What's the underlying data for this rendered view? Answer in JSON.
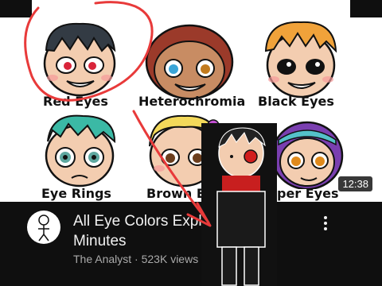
{
  "thumbnail": {
    "labels": {
      "red_eyes": "Red Eyes",
      "heterochromia": "Heterochromia",
      "black_eyes": "Black Eyes",
      "eye_rings": "Eye Rings",
      "brown_eyes": "Brown Ey",
      "amber_eyes": "per Eyes"
    },
    "duration": "12:38"
  },
  "video": {
    "title": "All Eye Colors Expla",
    "title_line2": "Minutes",
    "channel": "The Analyst",
    "separator": " · ",
    "views": "523K views",
    "trailing": " ·"
  },
  "colors": {
    "annotation_red": "#e83a3a",
    "background": "#0f0f0f",
    "title_text": "#f1f1f1",
    "subtitle_text": "#aaaaaa"
  },
  "icons": {
    "more": "more-vert-icon",
    "avatar": "stick-figure-avatar"
  }
}
